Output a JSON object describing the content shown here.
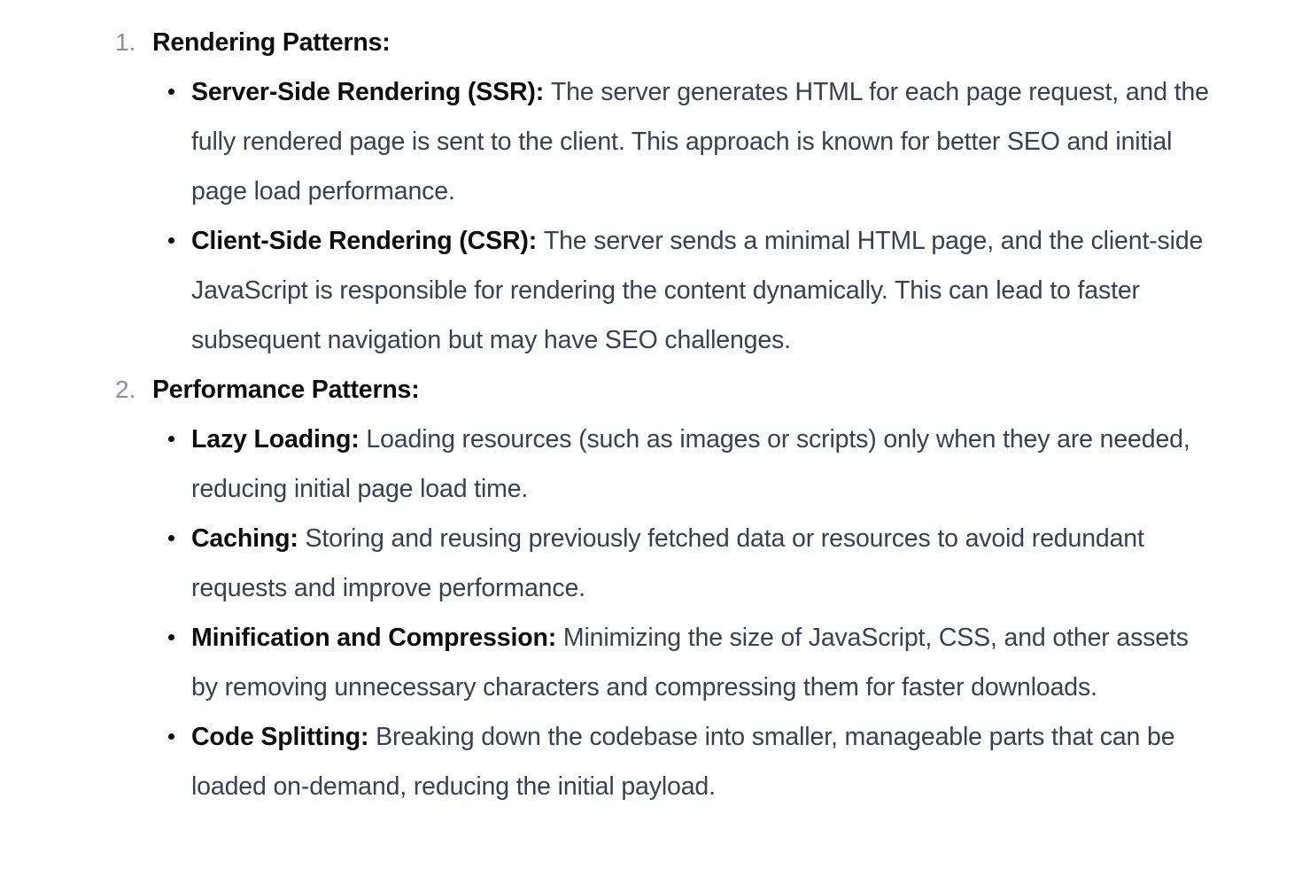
{
  "sections": [
    {
      "number": "1.",
      "title": "Rendering Patterns:",
      "items": [
        {
          "term": "Server-Side Rendering (SSR):",
          "desc": "The server generates HTML for each page request, and the fully rendered page is sent to the client. This approach is known for better SEO and initial page load performance."
        },
        {
          "term": "Client-Side Rendering (CSR):",
          "desc": "The server sends a minimal HTML page, and the client-side JavaScript is responsible for rendering the content dynamically. This can lead to faster subsequent navigation but may have SEO challenges."
        }
      ]
    },
    {
      "number": "2.",
      "title": "Performance Patterns:",
      "items": [
        {
          "term": "Lazy Loading:",
          "desc": "Loading resources (such as images or scripts) only when they are needed, reducing initial page load time."
        },
        {
          "term": "Caching:",
          "desc": "Storing and reusing previously fetched data or resources to avoid redundant requests and improve performance."
        },
        {
          "term": "Minification and Compression:",
          "desc": "Minimizing the size of JavaScript, CSS, and other assets by removing unnecessary characters and compressing them for faster downloads."
        },
        {
          "term": "Code Splitting:",
          "desc": "Breaking down the codebase into smaller, manageable parts that can be loaded on-demand, reducing the initial payload."
        }
      ]
    }
  ]
}
